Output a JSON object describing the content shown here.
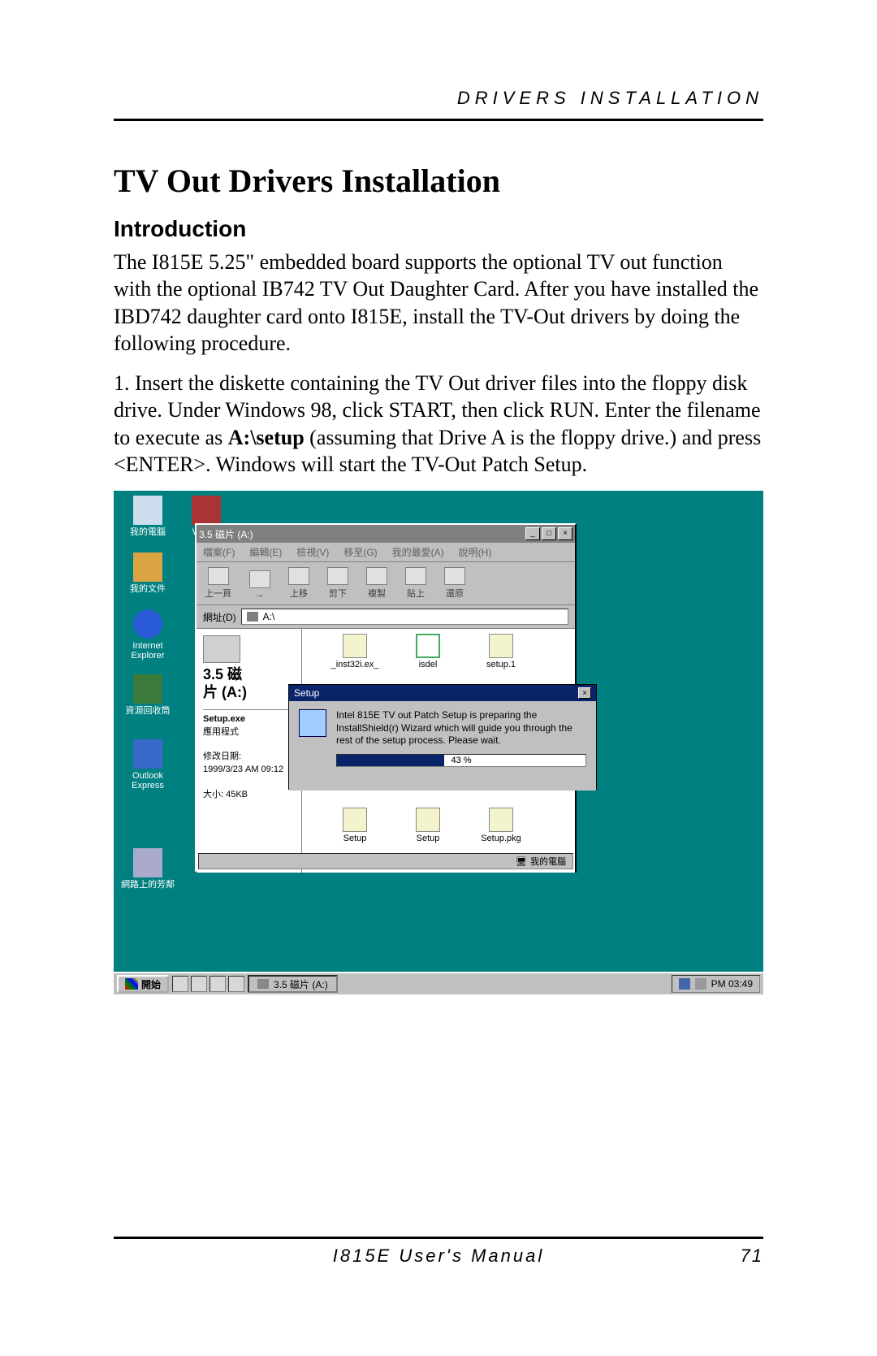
{
  "header": {
    "running": "DRIVERS INSTALLATION"
  },
  "title": "TV Out Drivers Installation",
  "subtitle": "Introduction",
  "para1": "The I815E 5.25\" embedded board supports the optional TV out function with the optional IB742 TV Out Daughter Card. After you have installed the IBD742 daughter card onto I815E, install the TV-Out drivers by doing the following procedure.",
  "para2_a": "1. Insert the diskette containing the TV Out driver files into the floppy disk drive. Under Windows 98, click START, then click RUN. Enter the filename to execute as ",
  "para2_bold": "A:\\setup",
  "para2_b": " (assuming that Drive A is the floppy drive.) and press <ENTER>. Windows will start the TV-Out Patch Setup.",
  "screenshot": {
    "desktop_icons": [
      {
        "name": "my-computer",
        "label": "我的電腦"
      },
      {
        "name": "winzip",
        "label": "WinZip"
      },
      {
        "name": "my-documents",
        "label": "我的文件"
      },
      {
        "name": "internet-explorer",
        "label": "Internet Explorer"
      },
      {
        "name": "recycle-bin",
        "label": "資源回收筒"
      },
      {
        "name": "outlook",
        "label": "Outlook Express"
      },
      {
        "name": "network",
        "label": "網路上的芳鄰"
      }
    ],
    "explorer": {
      "title": "3.5 磁片 (A:)",
      "menu": [
        "檔案(F)",
        "編輯(E)",
        "檢視(V)",
        "移至(G)",
        "我的最愛(A)",
        "說明(H)"
      ],
      "tools": [
        "上一頁",
        "→",
        "上移",
        "剪下",
        "複製",
        "貼上",
        "還原"
      ],
      "address_label": "網址(D)",
      "address_value": "A:\\",
      "left": {
        "drive_title_1": "3.5 磁",
        "drive_title_2": "片 (A:)",
        "file_name": "Setup.exe",
        "file_type": "應用程式",
        "file_date": "修改日期:",
        "file_date_val": "1999/3/23 AM 09:12",
        "file_size": "大小: 45KB"
      },
      "files": [
        {
          "label": "_inst32i.ex_"
        },
        {
          "label": "isdel"
        },
        {
          "label": "setup.1"
        },
        {
          "label": "Setup"
        },
        {
          "label": "Setup"
        },
        {
          "label": "Setup.pkg"
        }
      ],
      "status": "我的電腦"
    },
    "setup": {
      "title": "Setup",
      "message": "Intel 815E TV out Patch Setup is preparing the InstallShield(r) Wizard which will guide you through the rest of the setup process. Please wait.",
      "percent": "43 %"
    },
    "taskbar": {
      "start": "開始",
      "task": "3.5 磁片 (A:)",
      "clock": "PM 03:49"
    }
  },
  "footer": {
    "manual": "I815E User's Manual",
    "page": "71"
  }
}
